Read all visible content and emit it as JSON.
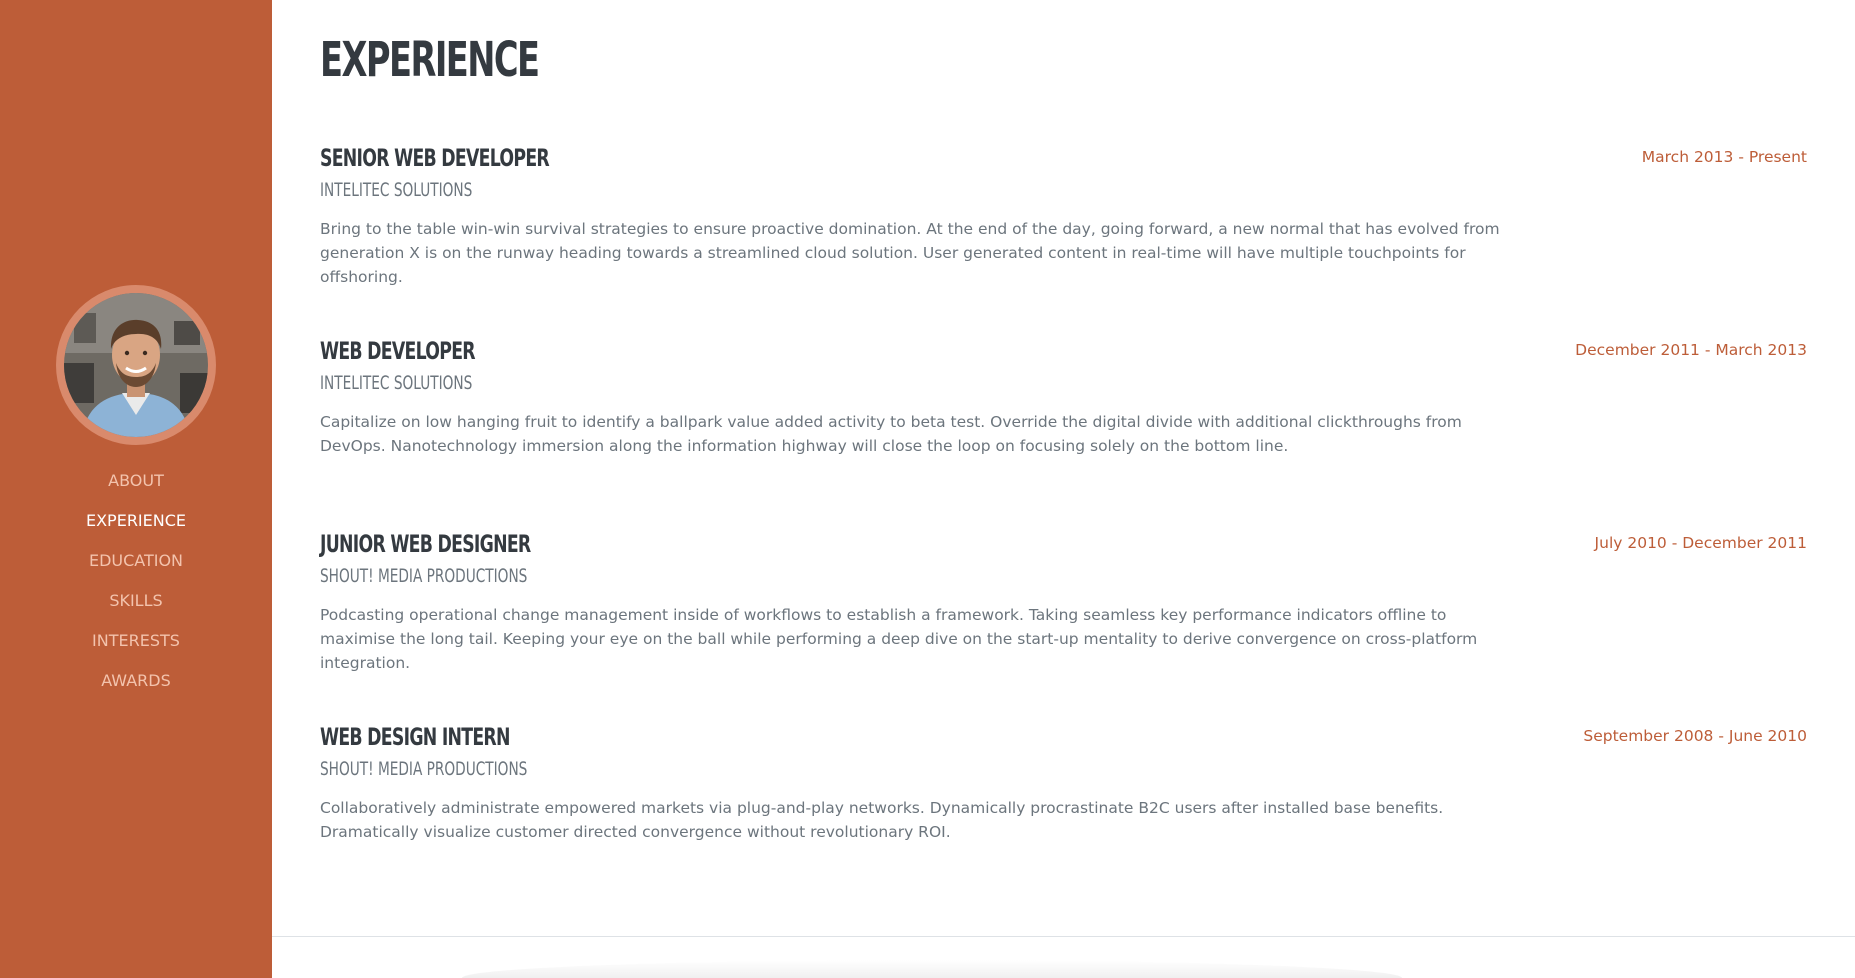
{
  "theme": {
    "accent": "#bd5d38",
    "heading": "#343a40",
    "muted": "#6c757d"
  },
  "sidebar": {
    "avatar_icon": "profile-photo",
    "nav": [
      {
        "label": "ABOUT",
        "active": false
      },
      {
        "label": "EXPERIENCE",
        "active": true
      },
      {
        "label": "EDUCATION",
        "active": false
      },
      {
        "label": "SKILLS",
        "active": false
      },
      {
        "label": "INTERESTS",
        "active": false
      },
      {
        "label": "AWARDS",
        "active": false
      }
    ]
  },
  "main": {
    "heading": "EXPERIENCE",
    "jobs": [
      {
        "title": "SENIOR WEB DEVELOPER",
        "company": "INTELITEC SOLUTIONS",
        "description": "Bring to the table win-win survival strategies to ensure proactive domination. At the end of the day, going forward, a new normal that has evolved from generation X is on the runway heading towards a streamlined cloud solution. User generated content in real-time will have multiple touchpoints for offshoring.",
        "date": "March 2013 - Present"
      },
      {
        "title": "WEB DEVELOPER",
        "company": "INTELITEC SOLUTIONS",
        "description": "Capitalize on low hanging fruit to identify a ballpark value added activity to beta test. Override the digital divide with additional clickthroughs from DevOps. Nanotechnology immersion along the information highway will close the loop on focusing solely on the bottom line.",
        "date": "December 2011 - March 2013"
      },
      {
        "title": "JUNIOR WEB DESIGNER",
        "company": "SHOUT! MEDIA PRODUCTIONS",
        "description": "Podcasting operational change management inside of workflows to establish a framework. Taking seamless key performance indicators offline to maximise the long tail. Keeping your eye on the ball while performing a deep dive on the start-up mentality to derive convergence on cross-platform integration.",
        "date": "July 2010 - December 2011"
      },
      {
        "title": "WEB DESIGN INTERN",
        "company": "SHOUT! MEDIA PRODUCTIONS",
        "description": "Collaboratively administrate empowered markets via plug-and-play networks. Dynamically procrastinate B2C users after installed base benefits. Dramatically visualize customer directed convergence without revolutionary ROI.",
        "date": "September 2008 - June 2010"
      }
    ]
  }
}
